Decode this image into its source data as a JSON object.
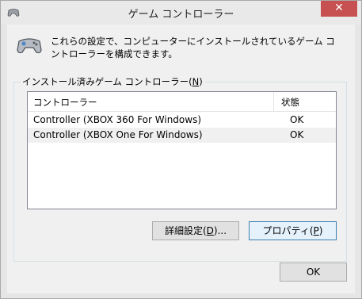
{
  "window": {
    "title": "ゲーム コントローラー",
    "close_glyph": "✕"
  },
  "description": "これらの設定で、コンピューターにインストールされているゲーム コントローラーを構成できます。",
  "group": {
    "label_prefix": "インストール済みゲーム コントローラー(",
    "label_key": "N",
    "label_suffix": ")"
  },
  "list": {
    "columns": [
      "コントローラー",
      "状態"
    ],
    "rows": [
      {
        "name": "Controller (XBOX 360 For Windows)",
        "status": "OK"
      },
      {
        "name": "Controller (XBOX One For Windows)",
        "status": "OK"
      }
    ]
  },
  "buttons": {
    "advanced_prefix": "詳細設定(",
    "advanced_key": "D",
    "advanced_suffix": ")...",
    "properties_prefix": "プロパティ(",
    "properties_key": "P",
    "properties_suffix": ")",
    "ok": "OK"
  }
}
